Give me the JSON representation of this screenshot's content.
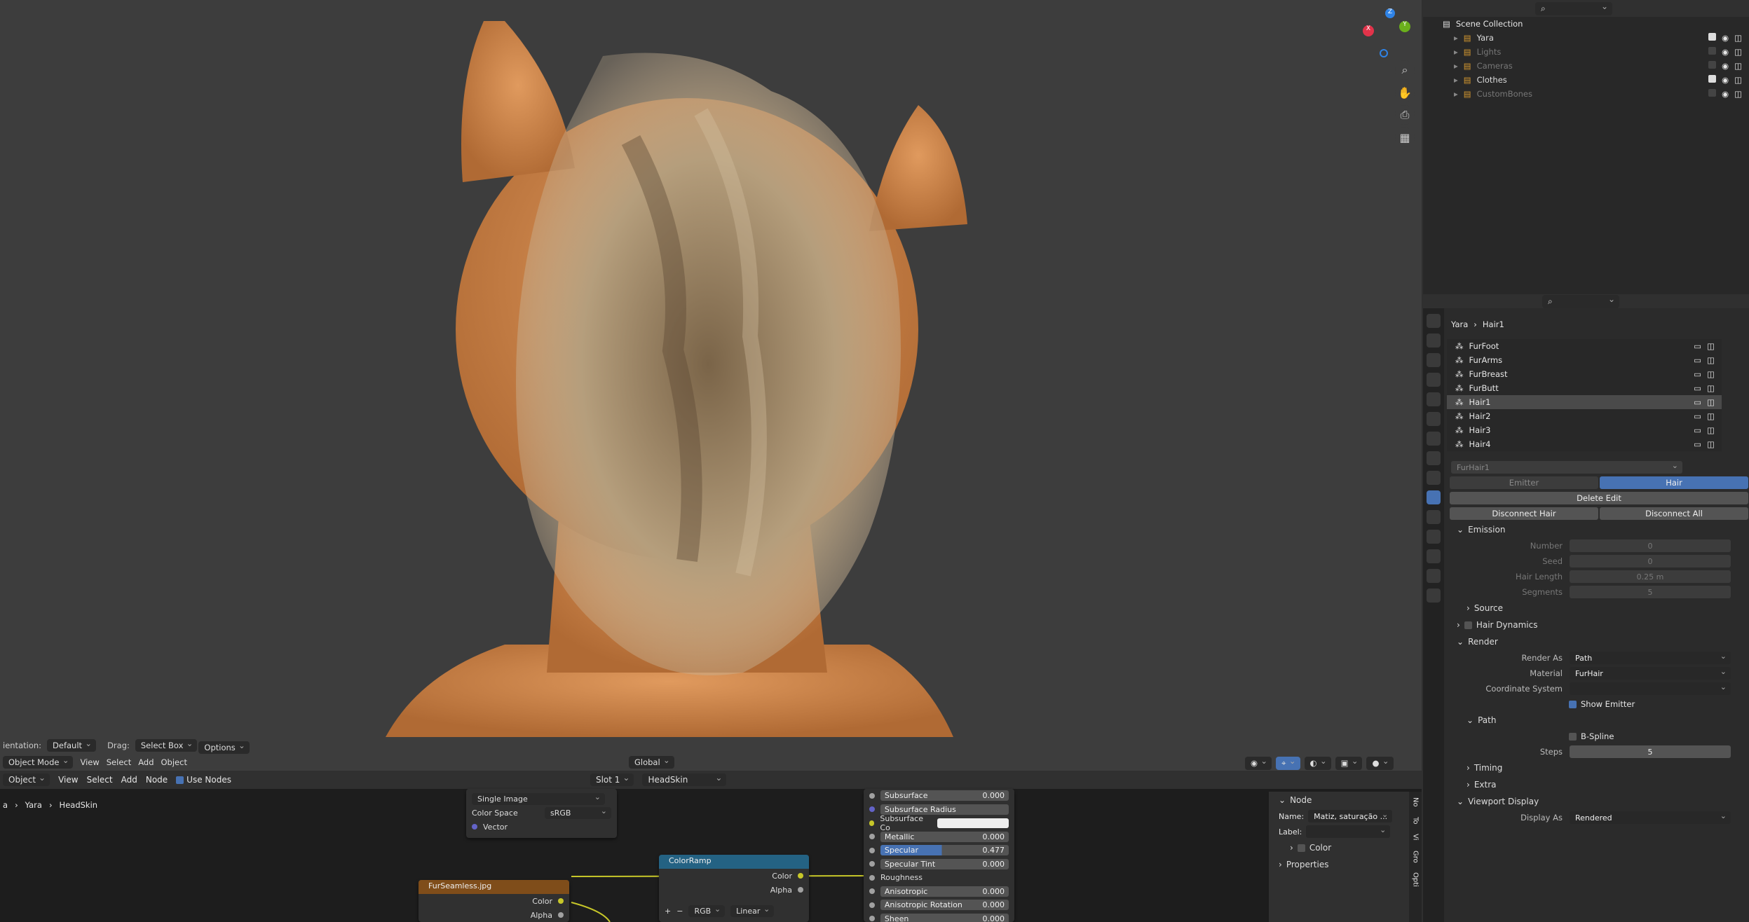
{
  "viewport": {
    "orientation_label": "ientation:",
    "orientation_value": "Default",
    "drag_label": "Drag:",
    "drag_value": "Select Box",
    "options_label": "Options",
    "transform_value": "Global"
  },
  "header3d": {
    "mode": "Object Mode",
    "menus": [
      "View",
      "Select",
      "Add",
      "Object"
    ]
  },
  "node_editor": {
    "editor_type": "Object",
    "menus": [
      "View",
      "Select",
      "Add",
      "Node"
    ],
    "use_nodes_label": "Use Nodes",
    "slot": "Slot 1",
    "material": "HeadSkin",
    "breadcrumb": [
      "a",
      "Yara",
      "HeadSkin"
    ],
    "image_node": {
      "source": "Single Image",
      "color_space_label": "Color Space",
      "color_space_value": "sRGB",
      "vector_label": "Vector"
    },
    "fur_node": {
      "title": "FurSeamless.jpg",
      "out_color": "Color",
      "out_alpha": "Alpha"
    },
    "colorramp_node": {
      "title": "ColorRamp",
      "out_color": "Color",
      "out_alpha": "Alpha",
      "mode": "RGB",
      "interp": "Linear",
      "plus": "+",
      "minus": "−"
    },
    "bsdf_rows": [
      {
        "label": "Subsurface",
        "value": "0.000"
      },
      {
        "label": "Subsurface Radius",
        "value": ""
      },
      {
        "label": "Subsurface Co",
        "value": ""
      },
      {
        "label": "Metallic",
        "value": "0.000"
      },
      {
        "label": "Specular",
        "value": "0.477"
      },
      {
        "label": "Specular Tint",
        "value": "0.000"
      },
      {
        "label": "Roughness",
        "value": ""
      },
      {
        "label": "Anisotropic",
        "value": "0.000"
      },
      {
        "label": "Anisotropic Rotation",
        "value": "0.000"
      },
      {
        "label": "Sheen",
        "value": "0.000"
      }
    ],
    "specular_fraction": 0.477,
    "sidebar": {
      "section": "Node",
      "name_label": "Name:",
      "name_value": "Matiz, saturação ...",
      "label_label": "Label:",
      "color_label": "Color",
      "properties_label": "Properties",
      "tabs": [
        "No",
        "To",
        "Vi",
        "Gro",
        "Opti"
      ]
    }
  },
  "outliner": {
    "title": "Scene Collection",
    "items": [
      {
        "name": "Yara",
        "dim": false
      },
      {
        "name": "Lights",
        "dim": true
      },
      {
        "name": "Cameras",
        "dim": true
      },
      {
        "name": "Clothes",
        "dim": false
      },
      {
        "name": "CustomBones",
        "dim": true
      }
    ]
  },
  "properties": {
    "breadcrumb_object": "Yara",
    "breadcrumb_system": "Hair1",
    "particle_list": [
      "FurFoot",
      "FurArms",
      "FurBreast",
      "FurButt",
      "Hair1",
      "Hair2",
      "Hair3",
      "Hair4"
    ],
    "selected_index": 4,
    "settings_name": "FurHair1",
    "type_tabs": [
      "Emitter",
      "Hair"
    ],
    "delete_edit": "Delete Edit",
    "disconnect_hair": "Disconnect Hair",
    "disconnect_all": "Disconnect All",
    "emission": {
      "title": "Emission",
      "rows": [
        {
          "label": "Number",
          "value": "0"
        },
        {
          "label": "Seed",
          "value": "0"
        },
        {
          "label": "Hair Length",
          "value": "0.25 m"
        },
        {
          "label": "Segments",
          "value": "5"
        }
      ],
      "source": "Source"
    },
    "hair_dynamics": "Hair Dynamics",
    "render": {
      "title": "Render",
      "render_as_label": "Render As",
      "render_as_value": "Path",
      "material_label": "Material",
      "material_value": "FurHair",
      "coord_label": "Coordinate System",
      "show_emitter": "Show Emitter",
      "path_title": "Path",
      "bspline": "B-Spline",
      "steps_label": "Steps",
      "steps_value": "5",
      "timing": "Timing",
      "extra": "Extra"
    },
    "viewport_display": {
      "title": "Viewport Display",
      "display_as_label": "Display As",
      "display_as_value": "Rendered"
    }
  },
  "colors": {
    "accent": "#4772b3",
    "skin": "#c8834a",
    "fur": "#a08a68"
  }
}
